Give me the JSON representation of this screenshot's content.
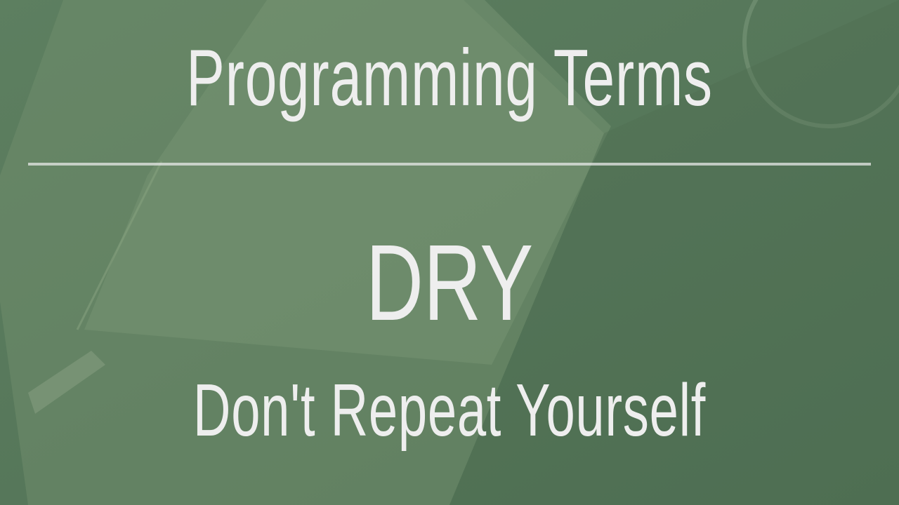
{
  "slide": {
    "title": "Programming Terms",
    "acronym": "DRY",
    "expansion": "Don't Repeat Yourself"
  },
  "colors": {
    "background": "#5a7a5e",
    "text": "#eeeeee",
    "rule": "#ebebeb"
  }
}
